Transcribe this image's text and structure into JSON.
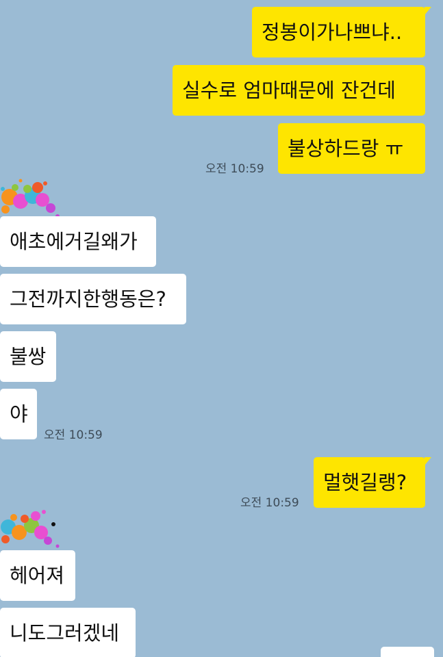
{
  "messages": {
    "m1": "정봉이가나쁘냐..",
    "m2": "실수로 엄마때문에 잔건데",
    "m3": "불상하드랑 ㅠ",
    "t1": "오전 10:59",
    "m4": "애초에거길왜가",
    "m5": "그전까지한행동은?",
    "m6": "불쌍",
    "m7": "야",
    "t2": "오전 10:59",
    "m8": "멀햇길랭?",
    "t3": "오전 10:59",
    "m9": "헤어져",
    "m10": "니도그러겠네"
  },
  "colors": {
    "background": "#9bbbd4",
    "sent_bubble": "#fee500",
    "received_bubble": "#ffffff"
  },
  "icons": [
    "paint-splatter-avatar-icon"
  ]
}
